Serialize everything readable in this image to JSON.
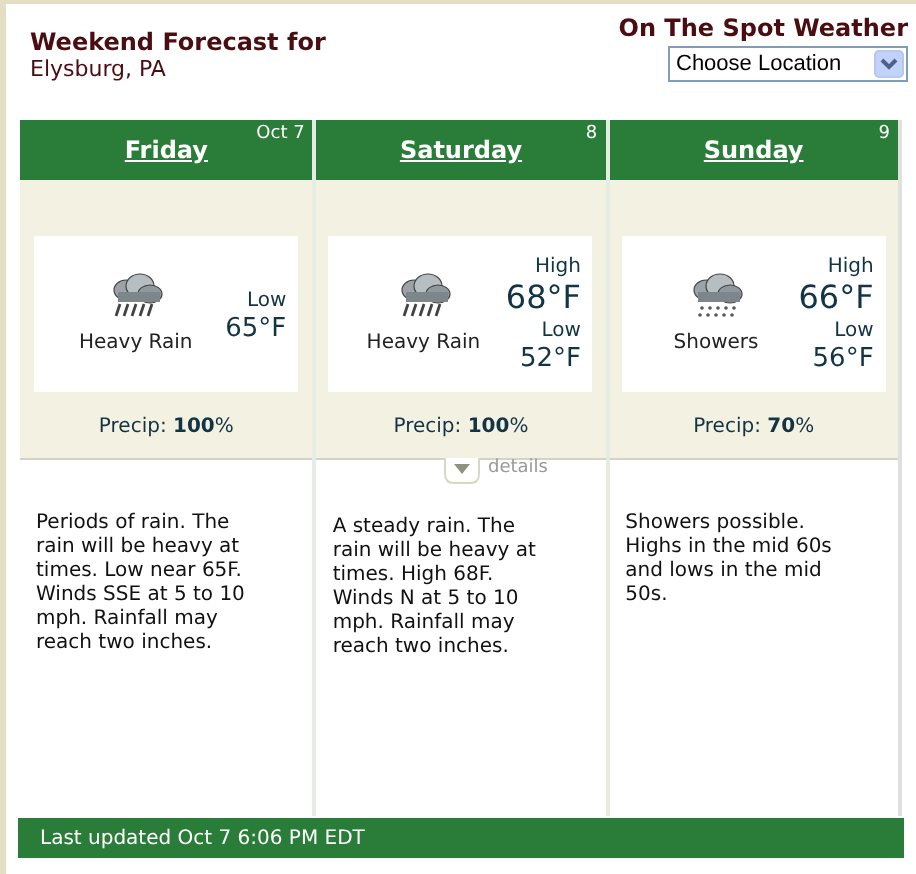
{
  "header": {
    "title": "Weekend Forecast for",
    "location": "Elysburg, PA",
    "brand": "On The Spot Weather",
    "location_select": {
      "value": "Choose Location"
    }
  },
  "days": [
    {
      "name": "Friday",
      "date": "Oct 7",
      "kind": "heavy-rain",
      "condition": "Heavy Rain",
      "low_label": "Low",
      "low": "65°F",
      "precip": "Precip: **100**%",
      "description": "Periods of rain. The rain will be heavy at times. Low near 65F. Winds SSE at 5 to 10 mph. Rainfall may reach two inches."
    },
    {
      "name": "Saturday",
      "date": "8",
      "kind": "heavy-rain",
      "condition": "Heavy Rain",
      "high_label": "High",
      "high": "68°F",
      "low_label": "Low",
      "low": "52°F",
      "precip": "Precip: **100**%",
      "description": "A steady rain. The rain will be heavy at times. High 68F. Winds N at 5 to 10 mph. Rainfall may reach two inches."
    },
    {
      "name": "Sunday",
      "date": "9",
      "kind": "showers",
      "condition": "Showers",
      "high_label": "High",
      "high": "66°F",
      "low_label": "Low",
      "low": "56°F",
      "precip": "Precip: **70**%",
      "description": "Showers possible. Highs in the mid 60s and lows in the mid 50s."
    }
  ],
  "details_toggle": {
    "label": "details"
  },
  "footer": {
    "text": "Last updated Oct 7 6:06 PM EDT"
  }
}
